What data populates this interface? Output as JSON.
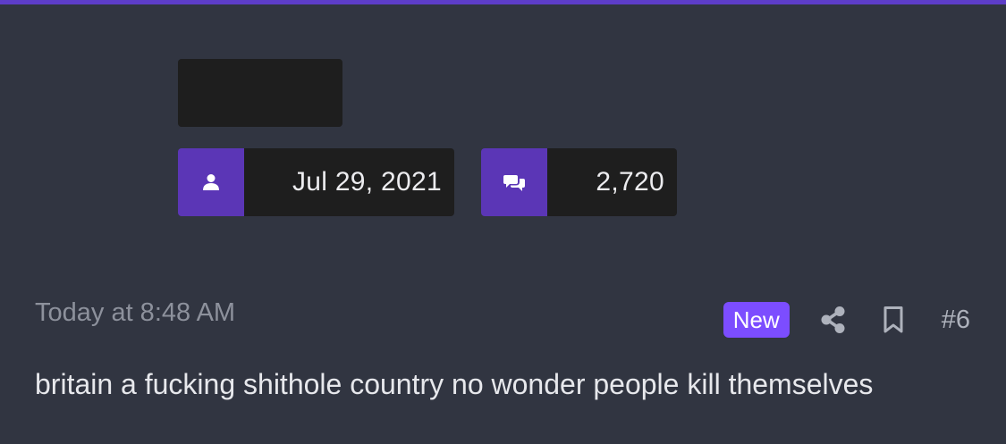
{
  "user": {
    "joined_icon": "user-icon",
    "joined_date": "Jul 29, 2021",
    "messages_icon": "comments-icon",
    "message_count": "2,720"
  },
  "post": {
    "timestamp": "Today at 8:48 AM",
    "new_badge": "New",
    "share_icon": "share-icon",
    "bookmark_icon": "bookmark-icon",
    "post_number": "#6",
    "body": "britain a fucking shithole country no wonder people kill themselves"
  },
  "colors": {
    "accent": "#5d3dc8",
    "badge": "#7c4dff",
    "background": "#313541",
    "dark_box": "#1e1e1e"
  }
}
